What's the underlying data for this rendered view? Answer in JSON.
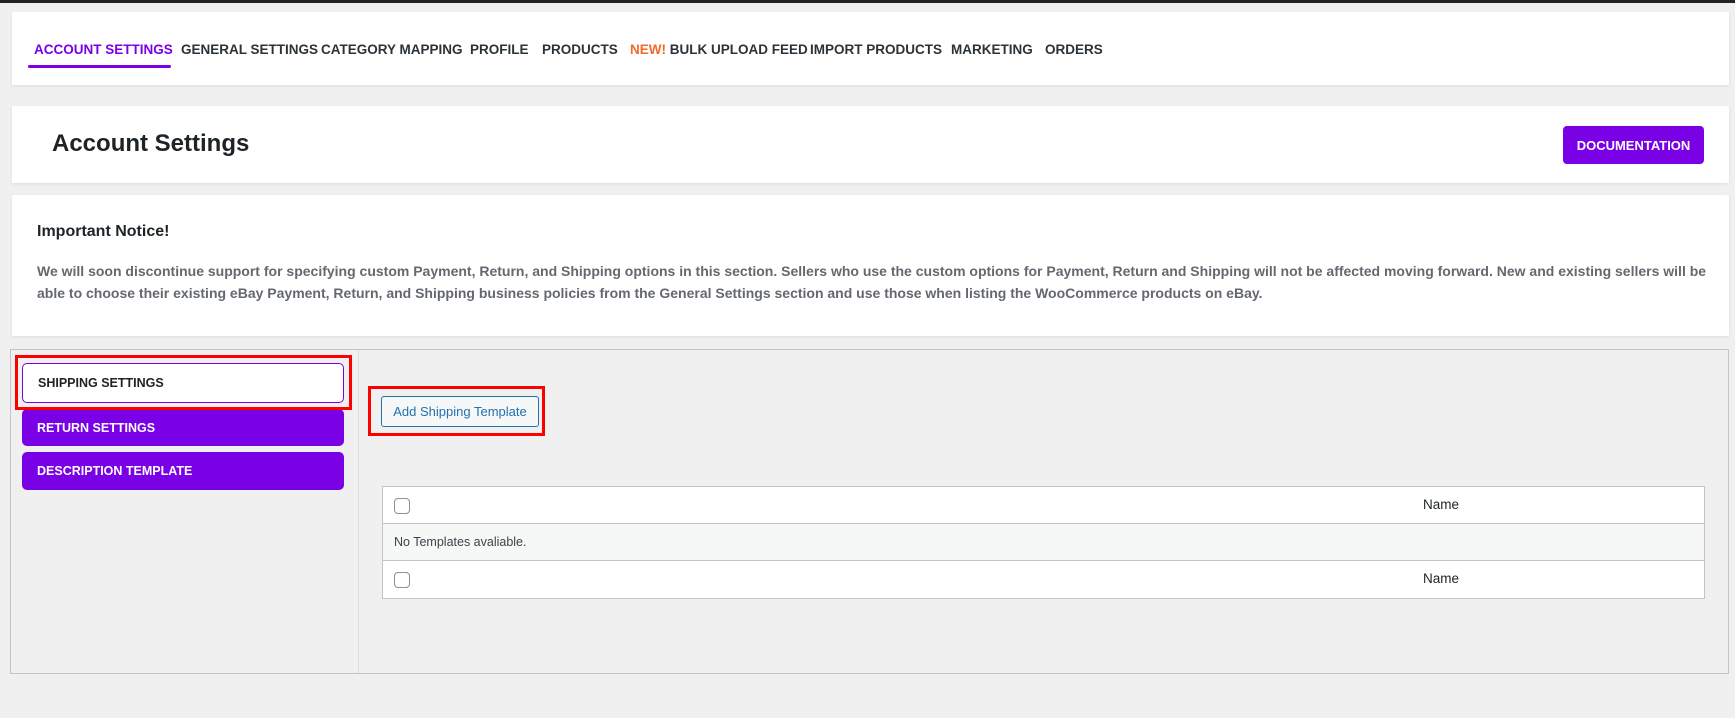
{
  "nav": {
    "items": [
      {
        "label": "ACCOUNT SETTINGS",
        "active": true
      },
      {
        "label": "GENERAL SETTINGS"
      },
      {
        "label": "CATEGORY MAPPING"
      },
      {
        "label": "PROFILE"
      },
      {
        "label": "PRODUCTS"
      },
      {
        "badge": "NEW!",
        "label": "BULK UPLOAD FEED"
      },
      {
        "label": "IMPORT PRODUCTS"
      },
      {
        "label": "MARKETING"
      },
      {
        "label": "ORDERS"
      }
    ]
  },
  "header": {
    "title": "Account Settings",
    "documentation_label": "DOCUMENTATION"
  },
  "notice": {
    "heading": "Important Notice!",
    "text": "We will soon discontinue support for specifying custom Payment, Return, and Shipping options in this section. Sellers who use the custom options for Payment, Return and Shipping will not be affected moving forward. New and existing sellers will be able to choose their existing eBay Payment, Return, and Shipping business policies from the General Settings section and use those when listing the WooCommerce products on eBay."
  },
  "sidebar": {
    "items": [
      {
        "label": "SHIPPING SETTINGS",
        "active": true
      },
      {
        "label": "RETURN SETTINGS"
      },
      {
        "label": "DESCRIPTION TEMPLATE"
      }
    ]
  },
  "main": {
    "add_button": "Add Shipping Template",
    "table": {
      "column_name": "Name",
      "empty_message": "No Templates avaliable."
    }
  },
  "colors": {
    "accent": "#7a00e6",
    "new_badge": "#f26b2b",
    "highlight": "#ff0000"
  }
}
